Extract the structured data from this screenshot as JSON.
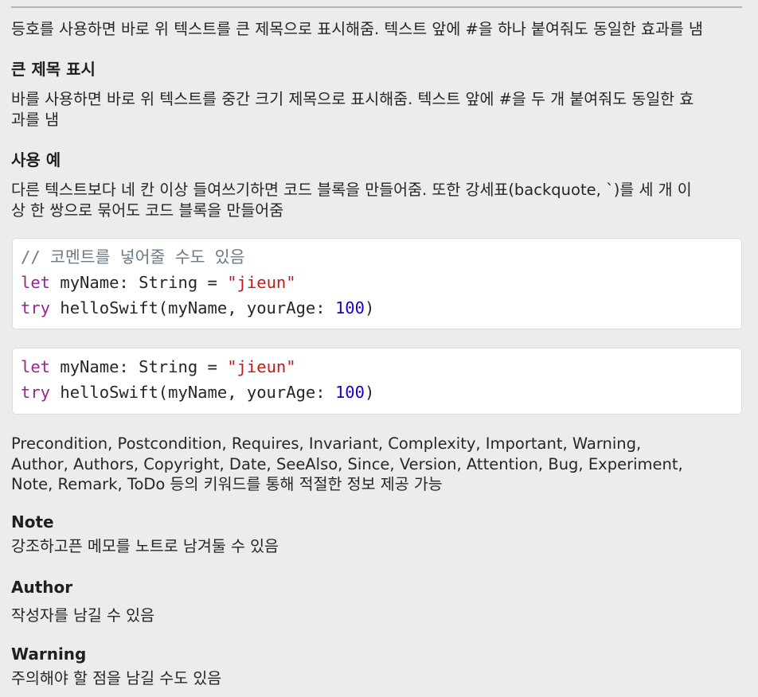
{
  "heading_markup": {
    "line1_intro": "등호를 사용하면 바로 위 텍스트를 큰 제목으로 표시해줌. 텍스트 앞에 #을 하나 붙여줘도 동일한 효과를 냄",
    "large_title_label": "큰 제목 표시",
    "line2_intro_a": "바를 사용하면 바로 위 텍스트를 중간 크기 제목으로 표시해줌. 텍스트 앞에 #을 두 개 붙여줘도 동일한 효",
    "line2_intro_b": "과를 냄"
  },
  "usage": {
    "title": "사용 예",
    "desc_a": "다른 텍스트보다 네 칸 이상 들여쓰기하면 코드 블록을 만들어줌. 또한 강세표(backquote, `)를 세 개 이",
    "desc_b": "상 한 쌍으로 묶어도 코드 블록을 만들어줌"
  },
  "code_block_1": {
    "comment": "// 코멘트를 넣어줄 수도 있음",
    "line1": {
      "kw": "let",
      "rest": " myName: String = ",
      "str": "\"jieun\""
    },
    "line2": {
      "kw": "try",
      "rest": " helloSwift(myName, yourAge: ",
      "num": "100",
      "end": ")"
    }
  },
  "code_block_2": {
    "line1": {
      "kw": "let",
      "rest": " myName: String = ",
      "str": "\"jieun\""
    },
    "line2": {
      "kw": "try",
      "rest": " helloSwift(myName, yourAge: ",
      "num": "100",
      "end": ")"
    }
  },
  "keywords": {
    "line1": "Precondition, Postcondition, Requires, Invariant, Complexity, Important, Warning,",
    "line2": "Author, Authors, Copyright, Date, SeeAlso, Since, Version, Attention, Bug, Experiment,",
    "line3": "Note, Remark, ToDo 등의 키워드를 통해 적절한 정보 제공 가능"
  },
  "sections": [
    {
      "title": "Note",
      "body": "강조하고픈 메모를 노트로 남겨둘 수 있음"
    },
    {
      "title": "Author",
      "body": "작성자를 남길 수 있음"
    },
    {
      "title": "Warning",
      "body": "주의해야 할 점을 남길 수도 있음"
    }
  ],
  "colors": {
    "keyword": "#9b2393",
    "string": "#c41a16",
    "number": "#1c00cf",
    "comment": "#6c7986"
  }
}
